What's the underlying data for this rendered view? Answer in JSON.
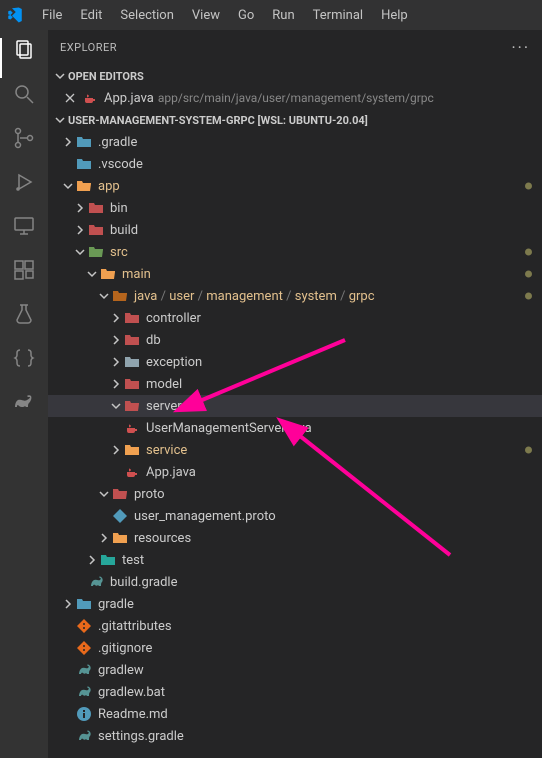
{
  "menu": [
    "File",
    "Edit",
    "Selection",
    "View",
    "Go",
    "Run",
    "Terminal",
    "Help"
  ],
  "explorer": {
    "title": "Explorer"
  },
  "openEditors": {
    "title": "Open Editors",
    "item": {
      "name": "App.java",
      "path": "app/src/main/java/user/management/system/grpc"
    }
  },
  "project": {
    "title": "USER-MANAGEMENT-SYSTEM-GRPC [WSL: UBUNTU-20.04]"
  },
  "tree": {
    "gradleFolder": ".gradle",
    "vscodeFolder": ".vscode",
    "app": "app",
    "bin": "bin",
    "build": "build",
    "src": "src",
    "main": "main",
    "javaPath": [
      "java",
      "user",
      "management",
      "system",
      "grpc"
    ],
    "controller": "controller",
    "db": "db",
    "exception": "exception",
    "model": "model",
    "server": "server",
    "umServer": "UserManagementServer.java",
    "service": "service",
    "appJava": "App.java",
    "proto": "proto",
    "protoFile": "user_management.proto",
    "resources": "resources",
    "test": "test",
    "buildGradle": "build.gradle",
    "gradleFolder2": "gradle",
    "gitattributes": ".gitattributes",
    "gitignore": ".gitignore",
    "gradlew": "gradlew",
    "gradlewBat": "gradlew.bat",
    "readme": "Readme.md",
    "settingsGradle": "settings.gradle"
  }
}
